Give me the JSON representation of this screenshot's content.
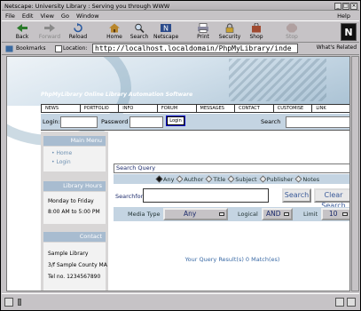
{
  "window": {
    "title": "Netscape: University Library : Serving you through WWW"
  },
  "menu": [
    "File",
    "Edit",
    "View",
    "Go",
    "Window"
  ],
  "menu_help": "Help",
  "toolbar": {
    "back": "Back",
    "forward": "Forward",
    "reload": "Reload",
    "home": "Home",
    "search": "Search",
    "netscape": "Netscape",
    "print": "Print",
    "security": "Security",
    "shop": "Shop",
    "stop": "Stop"
  },
  "location": {
    "bookmarks": "Bookmarks",
    "label": "Location:",
    "url": "http://localhost.localdomain/PhpMyLibrary/inde",
    "related": "What's Related"
  },
  "site": {
    "banner_title": "PhpMyLibrary Online Library Automation Software",
    "nav": [
      "NEWS",
      "PORTFOLIO",
      "INFO",
      "FORUM",
      "MESSAGES",
      "CONTACT",
      "CUSTOMISE",
      "LINK"
    ],
    "login_label": "Login:",
    "password_label": "Password",
    "login_button": "Login",
    "search_label": "Search"
  },
  "sidebar": {
    "main_menu": "Main Menu",
    "links": [
      "Home",
      "Login"
    ],
    "library_hours": "Library Hours",
    "hours_days": "Monday to Friday",
    "hours_time": "8:00 AM to 5:00 PM",
    "contact": "Contact",
    "contact_lines": [
      "Sample Library",
      "3/f Sample County MA",
      "Tel no. 1234567890"
    ]
  },
  "search_query": {
    "heading": "Search Query",
    "options": [
      "Any",
      "Author",
      "Title",
      "Subject",
      "Publisher",
      "Notes"
    ],
    "selected": "Any",
    "search_for_label": "Searchfor",
    "search_button": "Search",
    "clear_button": "Clear Search",
    "media_type_label": "Media Type",
    "media_type_value": "Any",
    "logical_label": "Logical",
    "logical_value": "AND",
    "limit_label": "Limit",
    "limit_value": "10",
    "result": "Your Query Result(s) 0 Match(es)"
  }
}
